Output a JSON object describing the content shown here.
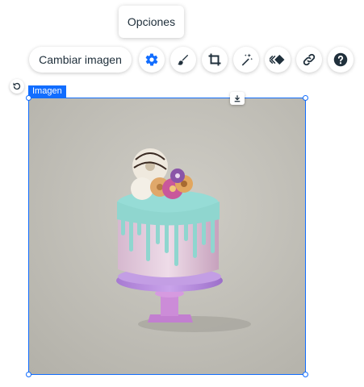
{
  "tooltip": {
    "text": "Opciones"
  },
  "toolbar": {
    "change_image_label": "Cambiar imagen",
    "buttons": [
      {
        "icon": "gear-icon",
        "active": true
      },
      {
        "icon": "brush-icon"
      },
      {
        "icon": "crop-icon"
      },
      {
        "icon": "magic-wand-icon"
      },
      {
        "icon": "animation-icon"
      },
      {
        "icon": "link-icon"
      },
      {
        "icon": "help-icon"
      }
    ]
  },
  "component": {
    "label": "Imagen"
  },
  "colors": {
    "accent": "#116dff",
    "text": "#20303c"
  },
  "image": {
    "subject": "drip-cake-on-pastel-stand"
  }
}
